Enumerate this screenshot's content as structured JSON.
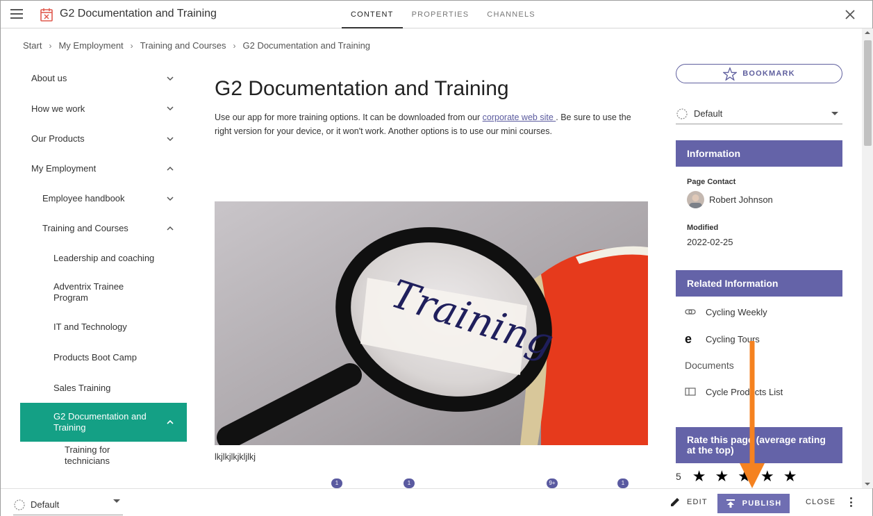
{
  "header": {
    "title": "G2 Documentation and Training",
    "tabs": [
      {
        "label": "CONTENT",
        "active": true
      },
      {
        "label": "PROPERTIES",
        "active": false
      },
      {
        "label": "CHANNELS",
        "active": false
      }
    ]
  },
  "breadcrumb": [
    "Start",
    "My Employment",
    "Training and Courses",
    "G2 Documentation and Training"
  ],
  "nav": [
    {
      "label": "About us",
      "level": 0,
      "chevron": "down"
    },
    {
      "label": "How we work",
      "level": 0,
      "chevron": "down"
    },
    {
      "label": "Our Products",
      "level": 0,
      "chevron": "down"
    },
    {
      "label": "My Employment",
      "level": 0,
      "chevron": "up"
    },
    {
      "label": "Employee handbook",
      "level": 1,
      "chevron": "down"
    },
    {
      "label": "Training and Courses",
      "level": 1,
      "chevron": "up"
    },
    {
      "label": "Leadership and coaching",
      "level": 2,
      "chevron": ""
    },
    {
      "label": "Adventrix Trainee Program",
      "level": 2,
      "chevron": ""
    },
    {
      "label": "IT and Technology",
      "level": 2,
      "chevron": ""
    },
    {
      "label": "Products Boot Camp",
      "level": 2,
      "chevron": ""
    },
    {
      "label": "Sales Training",
      "level": 2,
      "chevron": ""
    },
    {
      "label": "G2 Documentation and Training",
      "level": 2,
      "chevron": "up",
      "active": true
    },
    {
      "label": "Training for technicians",
      "level": 3,
      "chevron": ""
    }
  ],
  "main": {
    "heading": "G2 Documentation and Training",
    "intro_before": "Use our app for more training options. It can be downloaded from our ",
    "intro_link": "corporate web site ",
    "intro_after": ". Be sure to use the right version for your device, or it won't work. Another options is to use our mini courses.",
    "image_caption": "lkjlkjlkjkljlkj",
    "image_word": "Training",
    "badges": [
      "1",
      "1",
      "9+",
      "1"
    ]
  },
  "right": {
    "bookmark_label": "BOOKMARK",
    "view_select": "Default",
    "information": {
      "heading": "Information",
      "contact_label": "Page Contact",
      "contact_name": "Robert Johnson",
      "modified_label": "Modified",
      "modified_value": "2022-02-25"
    },
    "related": {
      "heading": "Related Information",
      "links": [
        "Cycling Weekly",
        "Cycling Tours"
      ],
      "documents_label": "Documents",
      "documents": [
        "Cycle Products List"
      ]
    },
    "rating": {
      "heading": "Rate this page (average rating at the top)",
      "value": "5",
      "stars": 5
    }
  },
  "footer": {
    "select_value": "Default",
    "edit_label": "EDIT",
    "publish_label": "PUBLISH",
    "close_label": "CLOSE"
  },
  "colors": {
    "accent": "#6463a8",
    "nav_active": "#14a085",
    "annotation_arrow": "#f58220"
  }
}
